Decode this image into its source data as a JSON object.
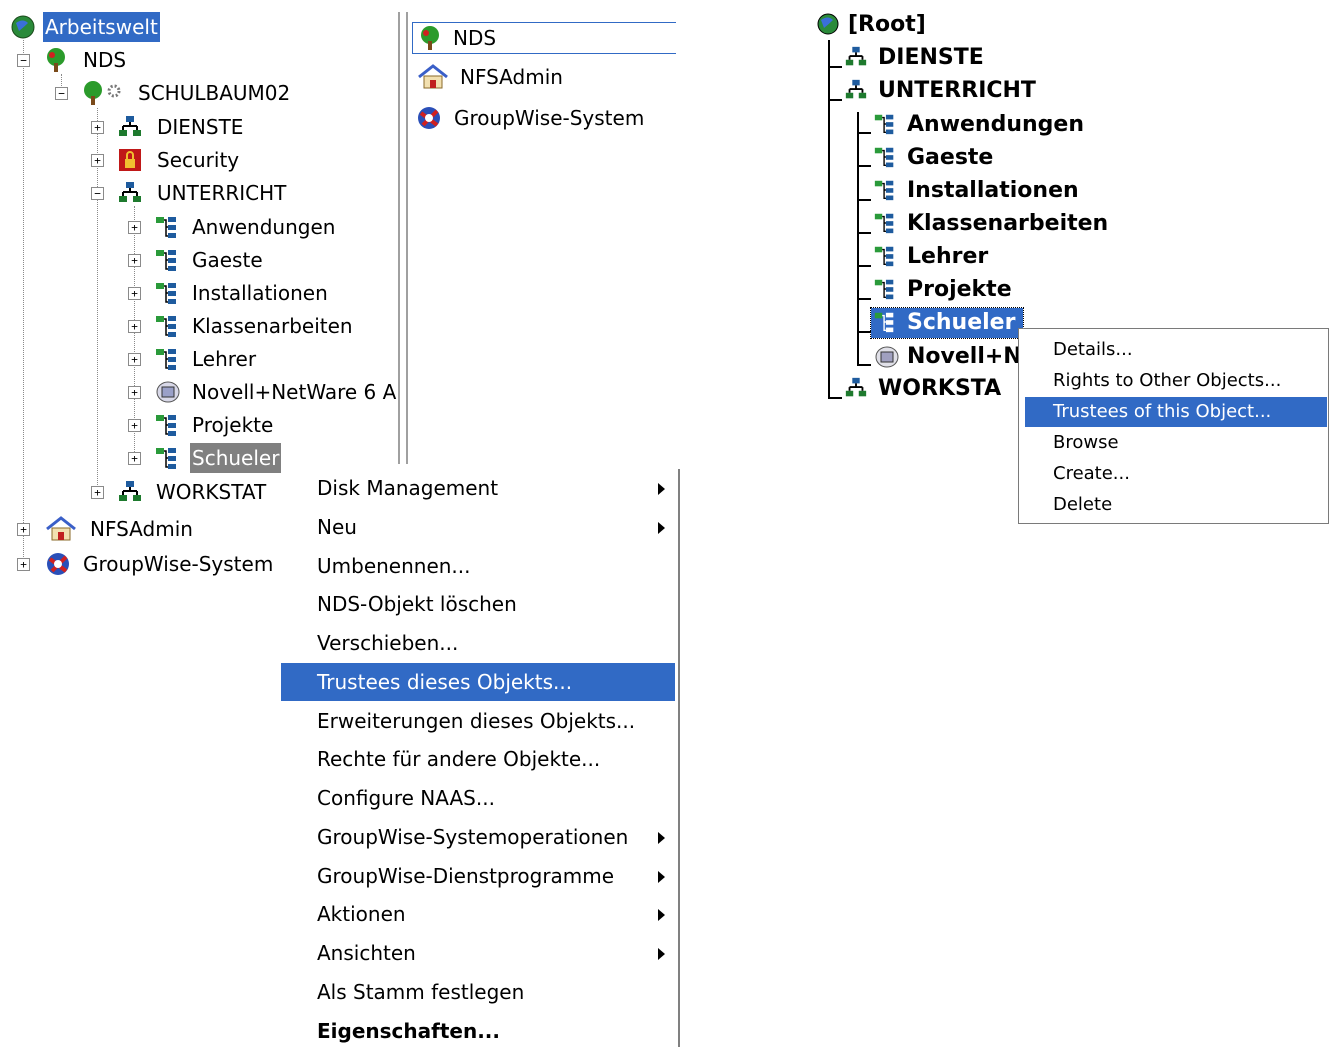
{
  "left_tree": {
    "root": "Arbeitswelt",
    "nds": "NDS",
    "tree_name": "SCHULBAUM02",
    "dienste": "DIENSTE",
    "security": "Security",
    "unterricht": "UNTERRICHT",
    "children": [
      "Anwendungen",
      "Gaeste",
      "Installationen",
      "Klassenarbeiten",
      "Lehrer",
      "Novell+NetWare 6 A",
      "Projekte",
      "Schueler"
    ],
    "workstat": "WORKSTAT",
    "nfsadmin": "NFSAdmin",
    "groupwise": "GroupWise-System"
  },
  "right_pane": {
    "items": [
      "NDS",
      "NFSAdmin",
      "GroupWise-System"
    ]
  },
  "context_menu": {
    "items": [
      {
        "label": "Disk Management",
        "submenu": true
      },
      {
        "label": "Neu",
        "submenu": true
      },
      {
        "label": "Umbenennen...",
        "submenu": false
      },
      {
        "label": "NDS-Objekt löschen",
        "submenu": false
      },
      {
        "label": "Verschieben...",
        "submenu": false
      },
      {
        "label": "Trustees dieses Objekts...",
        "submenu": false,
        "active": true
      },
      {
        "label": "Erweiterungen dieses Objekts...",
        "submenu": false
      },
      {
        "label": "Rechte für andere Objekte...",
        "submenu": false
      },
      {
        "label": "Configure NAAS...",
        "submenu": false
      },
      {
        "label": "GroupWise-Systemoperationen",
        "submenu": true
      },
      {
        "label": "GroupWise-Dienstprogramme",
        "submenu": true
      },
      {
        "label": "Aktionen",
        "submenu": true
      },
      {
        "label": "Ansichten",
        "submenu": true
      },
      {
        "label": "Als Stamm festlegen",
        "submenu": false
      },
      {
        "label": "Eigenschaften...",
        "submenu": false,
        "bold": true
      }
    ]
  },
  "right_tree": {
    "root": "[Root]",
    "dienste": "DIENSTE",
    "unterricht": "UNTERRICHT",
    "children": [
      "Anwendungen",
      "Gaeste",
      "Installationen",
      "Klassenarbeiten",
      "Lehrer",
      "Projekte",
      "Schueler"
    ],
    "novell": "Novell+N",
    "workstat": "WORKSTA"
  },
  "right_context_menu": {
    "items": [
      "Details...",
      "Rights to Other Objects...",
      "Trustees of this Object...",
      "Browse",
      "Create...",
      "Delete"
    ],
    "active_index": 2
  },
  "colors": {
    "selection": "#316ac5",
    "selection_gray": "#808080"
  }
}
